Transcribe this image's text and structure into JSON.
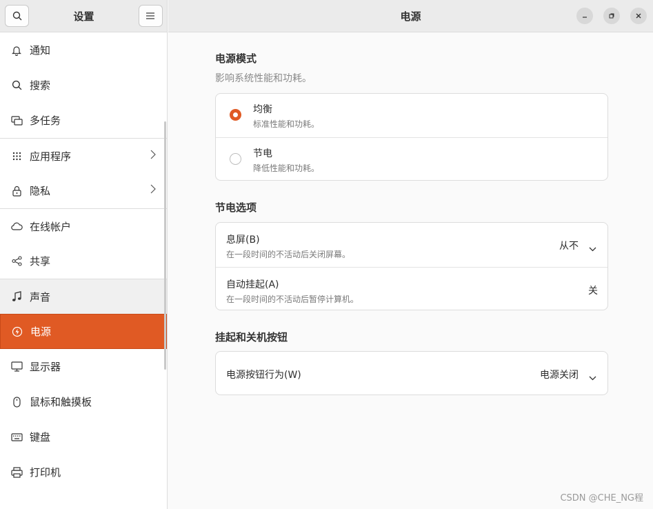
{
  "sidebar": {
    "title": "设置",
    "items": [
      {
        "label": "通知",
        "icon": "bell-icon"
      },
      {
        "label": "搜索",
        "icon": "search-icon"
      },
      {
        "label": "多任务",
        "icon": "multitask-icon"
      },
      {
        "label": "应用程序",
        "icon": "apps-grid-icon"
      },
      {
        "label": "隐私",
        "icon": "lock-icon"
      },
      {
        "label": "在线帐户",
        "icon": "cloud-icon"
      },
      {
        "label": "共享",
        "icon": "share-icon"
      },
      {
        "label": "声音",
        "icon": "music-note-icon"
      },
      {
        "label": "电源",
        "icon": "power-icon"
      },
      {
        "label": "显示器",
        "icon": "monitor-icon"
      },
      {
        "label": "鼠标和触摸板",
        "icon": "mouse-icon"
      },
      {
        "label": "键盘",
        "icon": "keyboard-icon"
      },
      {
        "label": "打印机",
        "icon": "printer-icon"
      }
    ]
  },
  "header": {
    "title": "电源"
  },
  "power_mode": {
    "title": "电源模式",
    "subtitle": "影响系统性能和功耗。",
    "options": [
      {
        "label": "均衡",
        "desc": "标准性能和功耗。",
        "selected": true
      },
      {
        "label": "节电",
        "desc": "降低性能和功耗。",
        "selected": false
      }
    ]
  },
  "saving": {
    "title": "节电选项",
    "rows": [
      {
        "label": "息屏(B)",
        "desc": "在一段时间的不活动后关闭屏幕。",
        "value": "从不"
      },
      {
        "label": "自动挂起(A)",
        "desc": "在一段时间的不活动后暂停计算机。",
        "value": "关"
      }
    ]
  },
  "buttons": {
    "title": "挂起和关机按钮",
    "rows": [
      {
        "label": "电源按钮行为(W)",
        "value": "电源关闭"
      }
    ]
  },
  "watermark": "CSDN @CHE_NG程",
  "colors": {
    "accent": "#e05a24"
  }
}
